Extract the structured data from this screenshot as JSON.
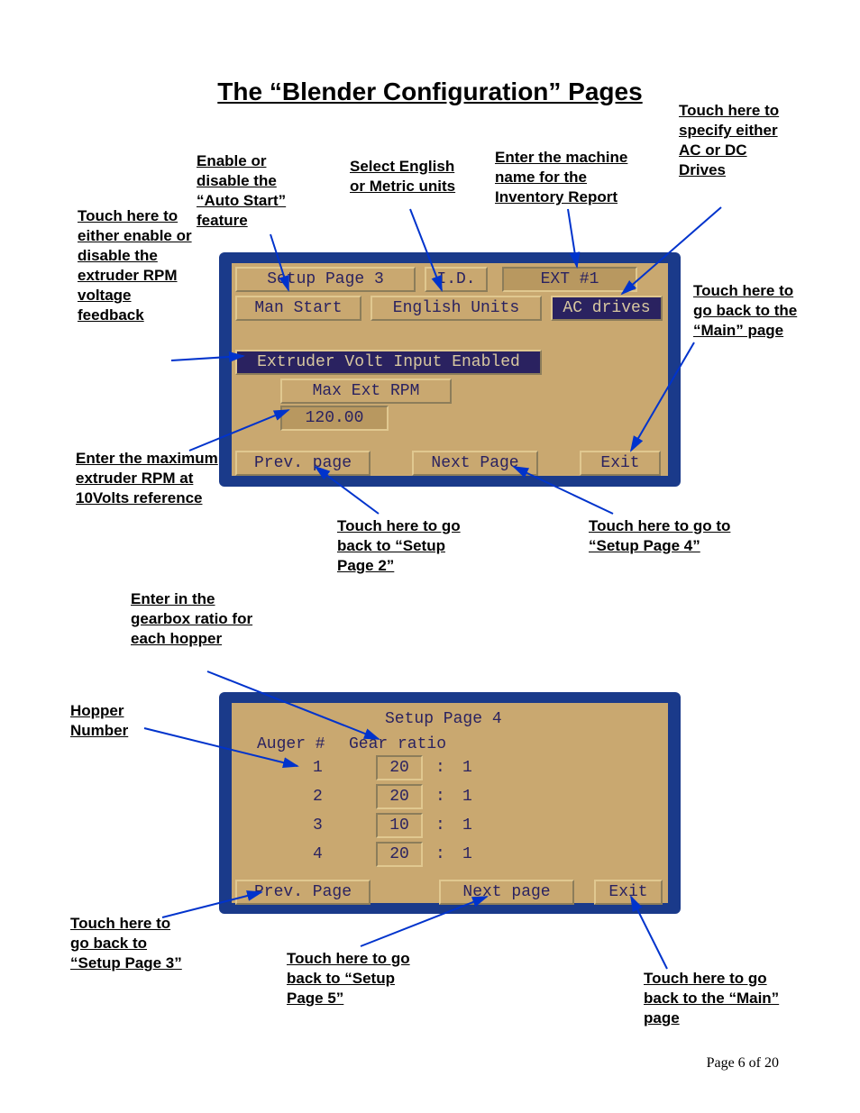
{
  "title": "The “Blender Configuration” Pages",
  "footer": "Page 6 of 20",
  "annotations": {
    "enable_autostart": "Enable or disable the “Auto Start” feature",
    "select_units": "Select English or Metric units",
    "enter_machine_name": "Enter the machine name for the Inventory Report",
    "ac_dc_drives": "Touch here to specify either AC or DC Drives",
    "rpm_voltage": "Touch here to either enable or disable the extruder RPM voltage feedback",
    "go_main_1": "Touch here to go back to the “Main” page",
    "max_rpm": "Enter the maximum extruder RPM at 10Volts reference",
    "go_setup2": "Touch here to go back to “Setup Page 2”",
    "go_setup4": "Touch here to go to “Setup Page 4”",
    "gearbox_ratio": "Enter in the gearbox ratio for each hopper",
    "hopper_number": "Hopper Number",
    "go_setup3": "Touch here to go back to “Setup Page 3”",
    "go_setup5": "Touch here to go back to “Setup Page 5”",
    "go_main_2": "Touch here to go back to the “Main” page"
  },
  "screen1": {
    "setup_page": "Setup Page 3",
    "id_label": "I.D.",
    "ext_name": "EXT #1",
    "man_start": "Man Start",
    "units": "English Units",
    "drives": "AC drives",
    "volt_input": "Extruder Volt Input Enabled",
    "max_ext_rpm_label": "Max Ext RPM",
    "max_ext_rpm_value": "120.00",
    "prev": "Prev. page",
    "next": "Next Page",
    "exit": "Exit"
  },
  "screen2": {
    "setup_page": "Setup Page 4",
    "auger_header": "Auger #",
    "gear_header": "Gear ratio",
    "rows": [
      {
        "n": "1",
        "a": "20",
        "sep": ":",
        "b": "1"
      },
      {
        "n": "2",
        "a": "20",
        "sep": ":",
        "b": "1"
      },
      {
        "n": "3",
        "a": "10",
        "sep": ":",
        "b": "1"
      },
      {
        "n": "4",
        "a": "20",
        "sep": ":",
        "b": "1"
      }
    ],
    "prev": "Prev. Page",
    "next": "Next page",
    "exit": "Exit"
  }
}
